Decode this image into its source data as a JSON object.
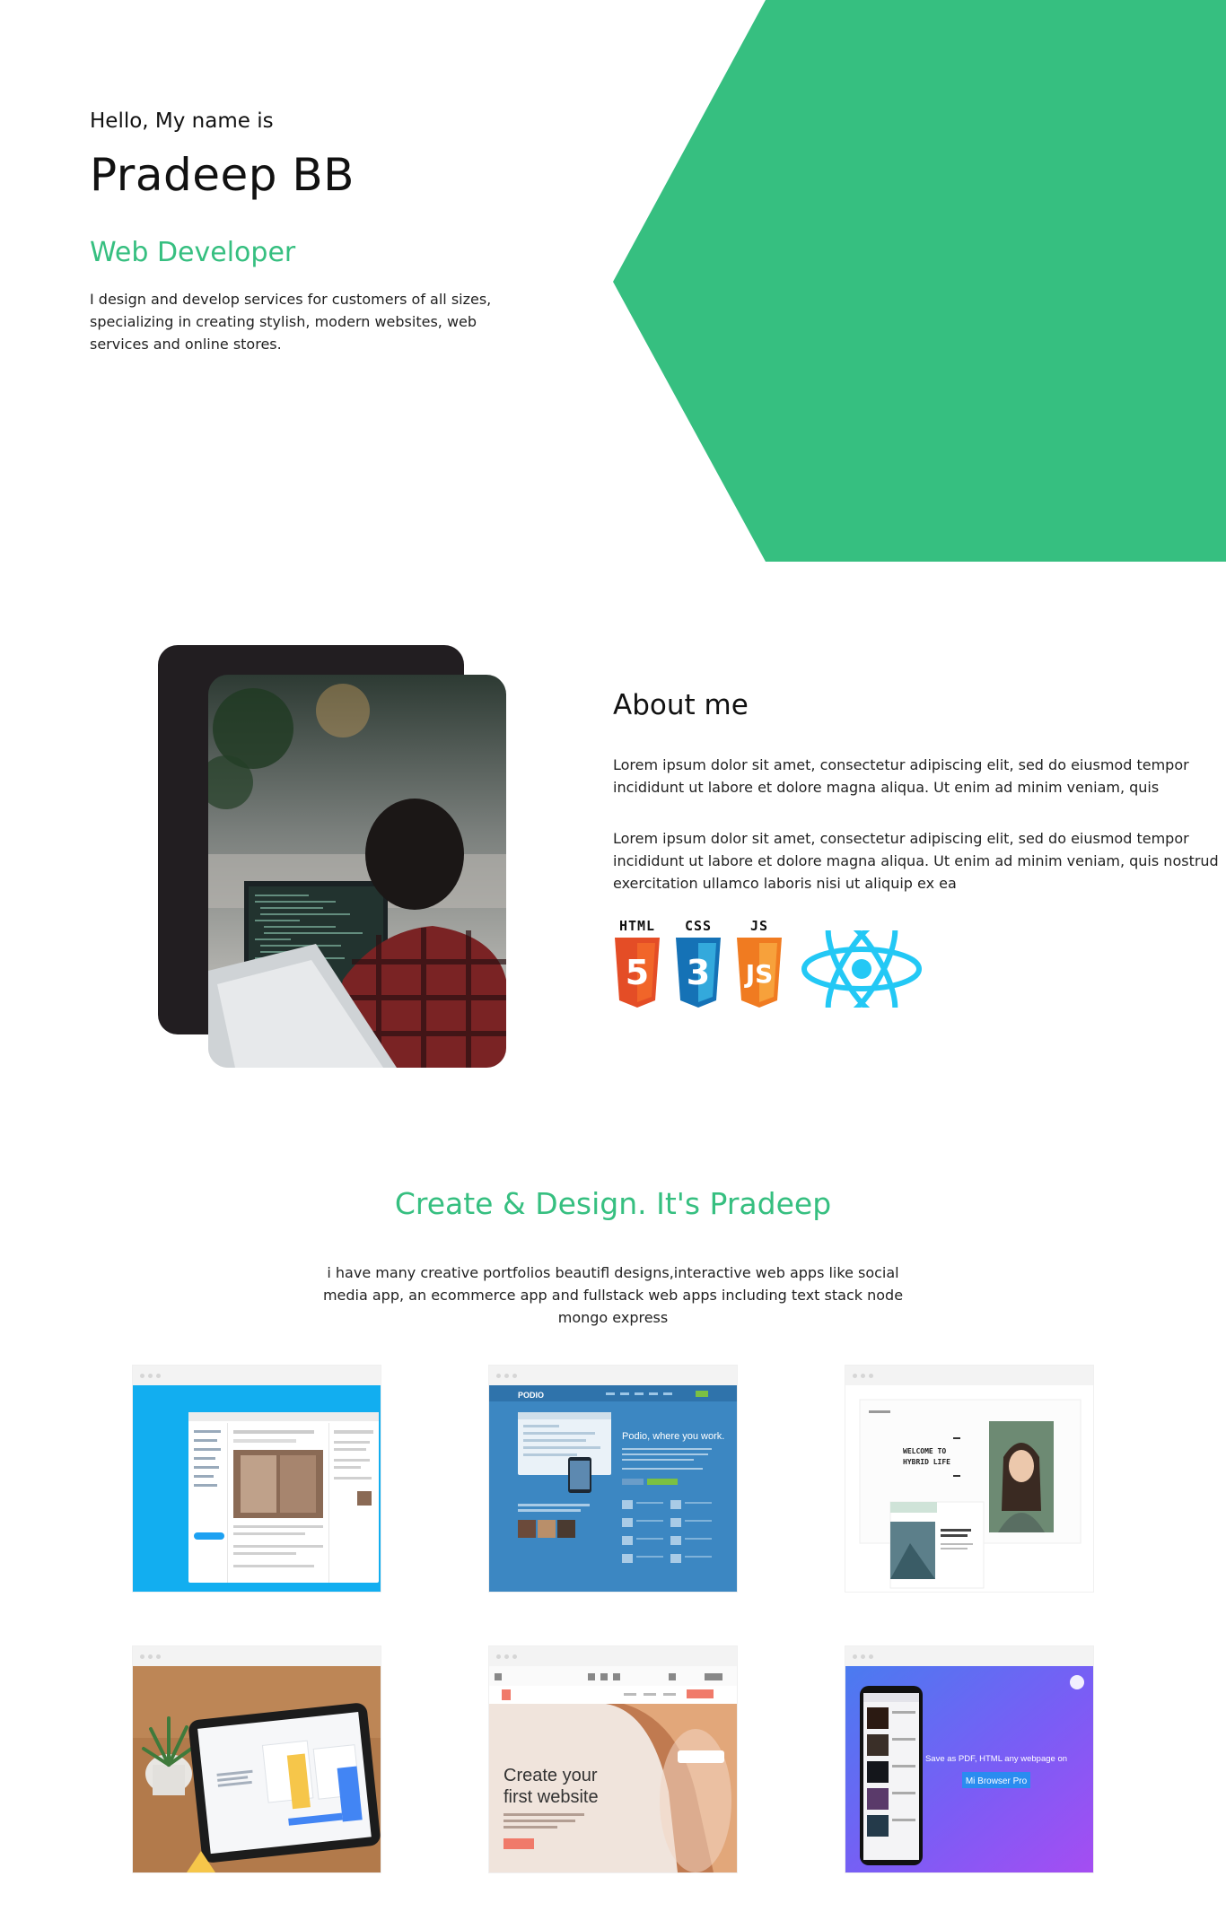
{
  "colors": {
    "accent": "#36bf80",
    "dark": "#221e21"
  },
  "hero": {
    "greeting": "Hello, My name is",
    "name": "Pradeep BB",
    "role": "Web Developer",
    "intro": "I design and develop services for customers of all sizes, specializing in creating stylish, modern websites, web services and online stores."
  },
  "about": {
    "title": "About me",
    "paragraph_1": "Lorem ipsum dolor sit amet, consectetur adipiscing elit, sed do eiusmod tempor incididunt ut labore et dolore magna aliqua. Ut enim ad minim veniam, quis",
    "paragraph_2": "Lorem ipsum dolor sit amet, consectetur adipiscing elit, sed do eiusmod tempor incididunt ut labore et dolore magna aliqua. Ut enim ad minim veniam, quis nostrud exercitation ullamco laboris nisi ut aliquip ex ea",
    "skills": [
      {
        "label": "HTML",
        "number": "5",
        "icon": "html5-icon",
        "color": "#e44d26"
      },
      {
        "label": "CSS",
        "number": "3",
        "icon": "css3-icon",
        "color": "#1572b6"
      },
      {
        "label": "JS",
        "number": "JS",
        "icon": "js-icon",
        "color": "#f07b21"
      },
      {
        "label": "",
        "icon": "react-icon",
        "color": "#23c8f5"
      }
    ]
  },
  "portfolio": {
    "title": "Create & Design. It's Pradeep",
    "description": "i have many creative portfolios beautifl designs,interactive web apps like social media app, an ecommerce app and fullstack web apps including text stack node mongo express",
    "cards": [
      {
        "kind": "social-app"
      },
      {
        "kind": "podio",
        "brand": "PODIO",
        "headline": "Podio, where you work."
      },
      {
        "kind": "hybrid",
        "headline": "WELCOME TO HYBRID LIFE"
      },
      {
        "kind": "tablet"
      },
      {
        "kind": "website-builder",
        "headline_1": "Create your",
        "headline_2": "first website"
      },
      {
        "kind": "mi-browser",
        "headline": "Save as PDF, HTML any webpage on",
        "button": "Mi Browser Pro"
      }
    ]
  }
}
